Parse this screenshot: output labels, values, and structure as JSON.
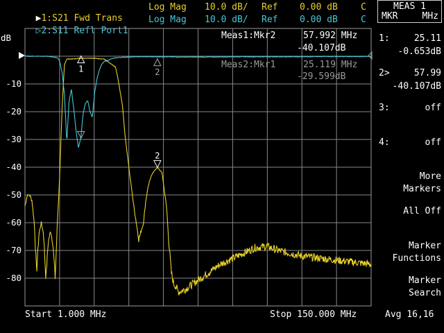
{
  "header": {
    "trace1": {
      "indicator": "▶",
      "name": "1:S21 Fwd Trans",
      "format": "Log Mag",
      "scale": "10.0 dB/",
      "ref_label": "Ref",
      "ref_value": "0.00 dB",
      "flag": "C"
    },
    "trace2": {
      "indicator": "▷",
      "name": "2:S11 Refl Port1",
      "format": "Log Mag",
      "scale": "10.0 dB/",
      "ref_label": "Ref",
      "ref_value": "0.00 dB",
      "flag": "C"
    }
  },
  "softkey_panel": {
    "title": "MEAS 1",
    "subtitle_left": "MKR",
    "subtitle_right": "MHz",
    "markers": [
      {
        "label": "1:",
        "value": "25.11",
        "sub": "-0.653dB"
      },
      {
        "label": "2>",
        "value": "57.99",
        "sub": "-40.107dB"
      },
      {
        "label": "3:",
        "value": "off"
      },
      {
        "label": "4:",
        "value": "off"
      }
    ],
    "buttons": [
      {
        "line1": "More",
        "line2": "Markers"
      },
      {
        "line1": "All Off",
        "line2": ""
      },
      {
        "line1": "Marker",
        "line2": "Functions"
      },
      {
        "line1": "Marker",
        "line2": "Search"
      }
    ]
  },
  "readouts": {
    "meas1": {
      "label": "Meas1:Mkr2",
      "freq": "57.992 MHz",
      "value": "-40.107dB"
    },
    "meas2": {
      "label": "Meas2:Mkr1",
      "freq": "25.119 MHz",
      "value": "-29.599dB"
    }
  },
  "footer": {
    "start": "Start 1.000 MHz",
    "stop": "Stop 150.000 MHz",
    "avg": "Avg 16,16"
  },
  "chart_data": {
    "type": "line",
    "ylabel": "dB",
    "y_ticks": [
      "-10",
      "-20",
      "-30",
      "-40",
      "-50",
      "-60",
      "-70",
      "-80"
    ],
    "xlim": [
      1,
      150
    ],
    "ylim": [
      -90,
      10
    ],
    "grid": true,
    "colors": {
      "trace1": "#e8d02a",
      "trace2": "#46c8d8",
      "grid": "#8a8a8a"
    },
    "series": [
      {
        "name": "S21",
        "x": [
          1,
          2,
          3,
          4,
          5,
          6,
          7,
          8,
          9,
          10,
          11,
          12,
          13,
          14,
          15,
          16,
          17,
          18,
          19,
          20,
          21,
          22,
          25,
          30,
          35,
          40,
          41,
          43,
          44,
          46,
          48,
          50,
          52,
          53,
          54,
          55,
          56,
          57,
          58,
          60,
          62,
          63,
          64,
          65,
          66,
          67,
          70,
          75,
          80,
          85,
          90,
          95,
          100,
          105,
          110,
          115,
          120,
          125,
          130,
          135,
          140,
          145,
          150
        ],
        "y": [
          -54,
          -50,
          -50,
          -52,
          -60,
          -78,
          -64,
          -60,
          -64,
          -80,
          -67,
          -63,
          -67,
          -80,
          -59,
          -42,
          -18,
          -3,
          -1,
          -1,
          -1,
          -1,
          -0.7,
          -0.7,
          -1,
          -4,
          -8,
          -18,
          -28,
          -42,
          -55,
          -66,
          -60,
          -52,
          -47,
          -44,
          -42,
          -41,
          -40.1,
          -42,
          -55,
          -68,
          -78,
          -82,
          -83,
          -85,
          -84,
          -81,
          -78,
          -75,
          -73,
          -71,
          -69,
          -68.5,
          -70,
          -71,
          -72,
          -72.5,
          -73,
          -73.5,
          -74,
          -74.5,
          -75
        ]
      },
      {
        "name": "S11",
        "x": [
          1,
          5,
          10,
          15,
          16,
          17,
          18,
          19,
          20,
          21,
          22,
          23,
          24,
          25,
          26,
          27,
          28,
          29,
          30,
          31,
          32,
          33,
          34,
          35,
          38,
          40,
          43,
          45,
          50,
          60,
          70,
          80,
          90,
          100,
          110,
          120,
          130,
          140,
          150
        ],
        "y": [
          0,
          0,
          0,
          -0.5,
          -2,
          -6,
          -14,
          -31,
          -16,
          -12,
          -19,
          -27,
          -33,
          -29.6,
          -21,
          -17,
          -16,
          -20,
          -22,
          -13,
          -8,
          -5,
          -3,
          -2,
          -1,
          -0.6,
          -0.4,
          -0.3,
          -0.2,
          -0.2,
          -0.3,
          -0.3,
          -0.2,
          -0.2,
          -0.2,
          -0.2,
          -0.1,
          -0.1,
          -0.1
        ]
      }
    ],
    "markers": [
      {
        "label": "1",
        "trace": "S21",
        "x": 25.119,
        "y": -0.653
      },
      {
        "label": "1",
        "trace": "S11",
        "x": 25.119,
        "y": -29.599
      },
      {
        "label": "2",
        "trace": "S21",
        "x": 57.992,
        "y": -40.107
      },
      {
        "label": "2",
        "trace": "S11",
        "x": 57.992,
        "y": -0.2
      }
    ]
  }
}
